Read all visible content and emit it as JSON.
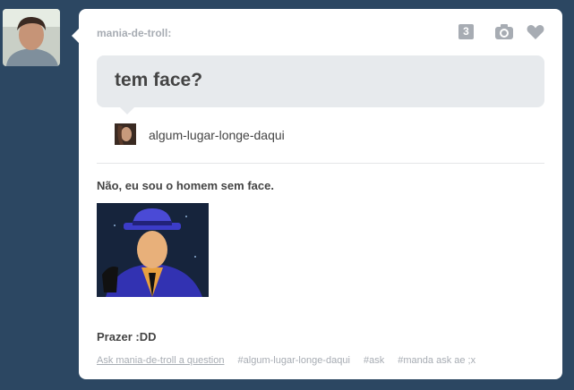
{
  "post": {
    "username": "mania-de-troll:",
    "note_count": "3",
    "question": "tem face?",
    "asker": "algum-lugar-longe-daqui",
    "answer": "Não, eu sou o homem sem face.",
    "answer_2": "Prazer :DD",
    "ask_link": "Ask mania-de-troll a question",
    "tags": [
      "#algum-lugar-longe-daqui",
      "#ask",
      "#manda ask ae ;x"
    ]
  },
  "icons": {
    "reblog": "camera-icon",
    "like": "heart-icon"
  },
  "colors": {
    "background": "#2c4762",
    "card": "#ffffff",
    "bubble": "#e7eaed",
    "muted": "#a7acb3",
    "text": "#444444"
  }
}
